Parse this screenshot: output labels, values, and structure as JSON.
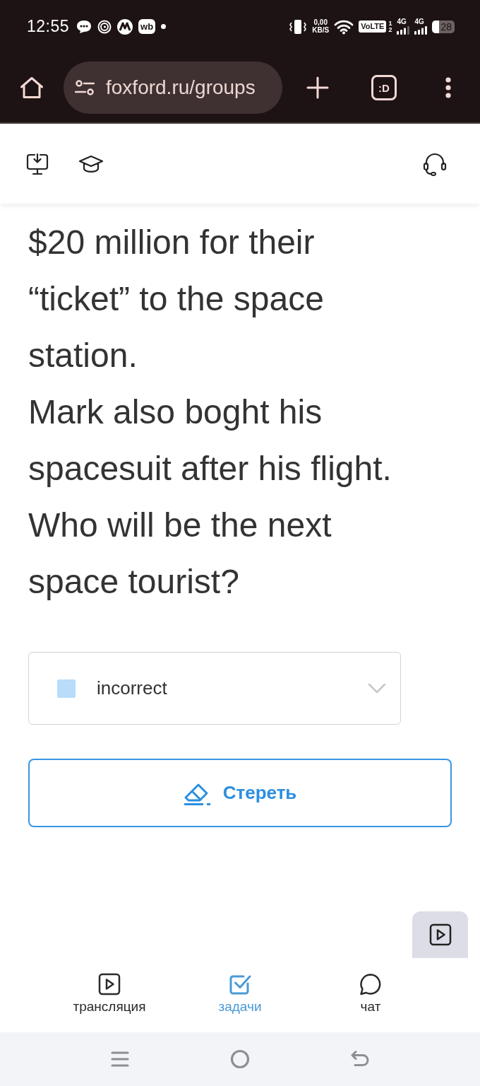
{
  "status_bar": {
    "time": "12:55",
    "notification_badge": "wb",
    "net_speed_value": "0,00",
    "net_speed_unit": "KB/S",
    "volte": "VoLTE",
    "sim_slots": [
      "1",
      "2"
    ],
    "network_types": [
      "4G",
      "4G"
    ],
    "battery": "28"
  },
  "browser": {
    "url": "foxford.ru/groups",
    "tab_switcher": ":D"
  },
  "content": {
    "paragraphs": [
      "$20 million for their “ticket” to the space station.",
      "Mark also boght his spacesuit after his flight.",
      "Who will be the next space tourist?"
    ],
    "dropdown": {
      "value": "incorrect"
    },
    "erase_button": "Стереть"
  },
  "bottom_nav": {
    "items": [
      {
        "label": "трансляция",
        "selected": false
      },
      {
        "label": "задачи",
        "selected": true
      },
      {
        "label": "чат",
        "selected": false
      }
    ]
  }
}
